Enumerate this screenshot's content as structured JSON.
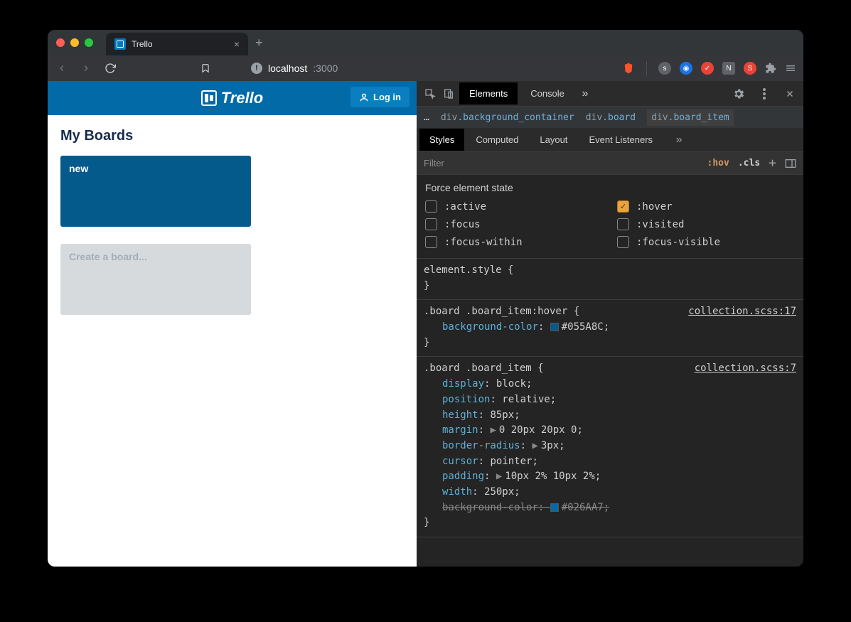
{
  "browser": {
    "tab_title": "Trello",
    "url_host": "localhost",
    "url_port": ":3000",
    "new_tab_glyph": "+",
    "close_glyph": "×"
  },
  "app": {
    "brand": "Trello",
    "login_label": "Log in",
    "page_title": "My Boards",
    "boards": [
      {
        "label": "new"
      }
    ],
    "create_label": "Create a board..."
  },
  "devtools": {
    "tabs": [
      "Elements",
      "Console"
    ],
    "active_tab": "Elements",
    "more_glyph": "»",
    "breadcrumb_ellipsis": "…",
    "breadcrumb": [
      {
        "tag": "div",
        "cls": ".background_container"
      },
      {
        "tag": "div",
        "cls": ".board"
      },
      {
        "tag": "div",
        "cls": ".board_item"
      }
    ],
    "subtabs": [
      "Styles",
      "Computed",
      "Layout",
      "Event Listeners"
    ],
    "active_subtab": "Styles",
    "filter_placeholder": "Filter",
    "hov_label": ":hov",
    "cls_label": ".cls",
    "force_title": "Force element state",
    "states": [
      {
        "label": ":active",
        "checked": false
      },
      {
        "label": ":hover",
        "checked": true
      },
      {
        "label": ":focus",
        "checked": false
      },
      {
        "label": ":visited",
        "checked": false
      },
      {
        "label": ":focus-within",
        "checked": false
      },
      {
        "label": ":focus-visible",
        "checked": false
      }
    ],
    "rules": [
      {
        "selector": "element.style",
        "src": "",
        "decls": []
      },
      {
        "selector": ".board .board_item:hover",
        "src": "collection.scss:17",
        "decls": [
          {
            "prop": "background-color",
            "val": "#055A8C",
            "swatch": "#055A8C"
          }
        ]
      },
      {
        "selector": ".board .board_item",
        "src": "collection.scss:7",
        "decls": [
          {
            "prop": "display",
            "val": "block"
          },
          {
            "prop": "position",
            "val": "relative"
          },
          {
            "prop": "height",
            "val": "85px"
          },
          {
            "prop": "margin",
            "val": "0 20px 20px 0",
            "tri": true
          },
          {
            "prop": "border-radius",
            "val": "3px",
            "tri": true
          },
          {
            "prop": "cursor",
            "val": "pointer"
          },
          {
            "prop": "padding",
            "val": "10px 2% 10px 2%",
            "tri": true
          },
          {
            "prop": "width",
            "val": "250px"
          },
          {
            "prop": "background-color",
            "val": "#026AA7",
            "swatch": "#026AA7",
            "strike": true
          }
        ]
      }
    ]
  }
}
